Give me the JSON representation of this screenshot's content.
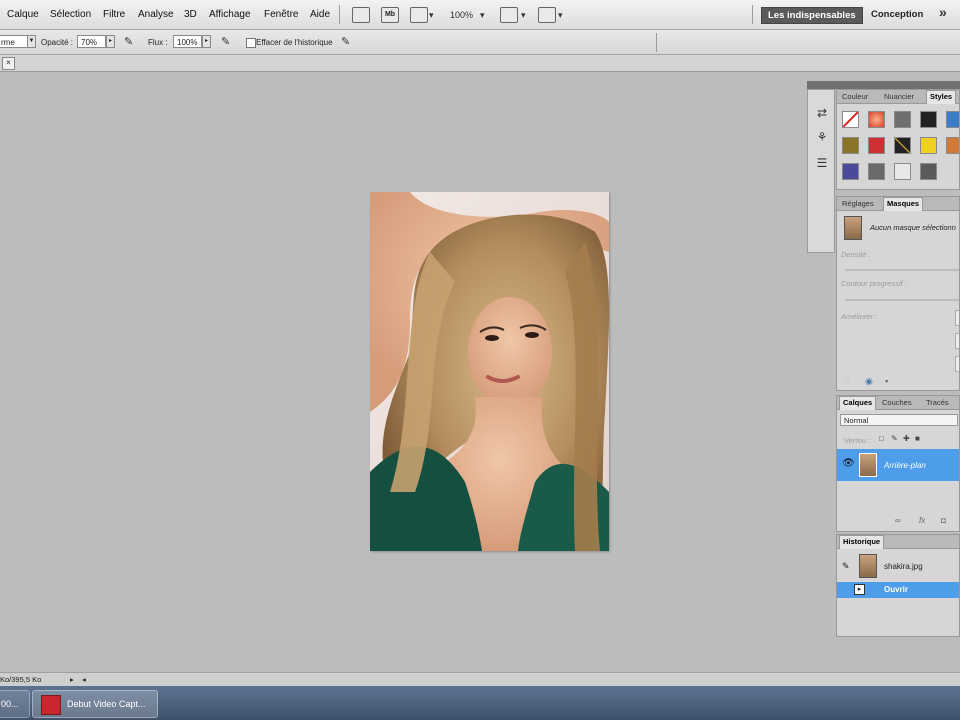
{
  "menubar": {
    "items": [
      "Calque",
      "Sélection",
      "Filtre",
      "Analyse",
      "3D",
      "Affichage",
      "Fenêtre",
      "Aide"
    ],
    "zoom": "100%",
    "workspace_active": "Les indispensables",
    "workspace_other": "Conception",
    "more": "»"
  },
  "options": {
    "mode_value": "rme",
    "opacity_label": "Opacité :",
    "opacity_value": "70%",
    "flow_label": "Flux :",
    "flow_value": "100%",
    "erase_history_label": "Effacer de l'historique"
  },
  "panels": {
    "top_tabs": [
      "Couleur",
      "Nuancier",
      "Styles"
    ],
    "masks_tabs": [
      "Réglages",
      "Masques"
    ],
    "masks_selection_text": "Aucun masque sélectionn",
    "masks_density_label": "Densité :",
    "masks_feather_label": "Contour progressif :",
    "masks_refine_label": "Améliorer :",
    "layers_tabs": [
      "Calques",
      "Couches",
      "Tracés"
    ],
    "layers_blend_mode": "Normal",
    "layers_lock_label": "Verrou :",
    "layers_item_name": "Arrière-plan",
    "history_tab": "Historique",
    "history_source": "shakira.jpg",
    "history_step": "Ouvrir"
  },
  "statusbar": {
    "info": "Ko/395,5 Ko"
  },
  "taskbar": {
    "left_item": "00...",
    "active_item": "Debut Video Capt..."
  },
  "colors": {
    "layer_highlight": "#4e9dea",
    "workspace_active_bg": "#5a5a5a",
    "canvas_bg": "#bcbcbc"
  },
  "icons": [
    "brush-airbrush-icon",
    "move-icon",
    "zoom-icon",
    "screen-mode-icon",
    "arrange-icon",
    "eye-icon",
    "lock-icon",
    "link-icon",
    "fx-icon"
  ]
}
